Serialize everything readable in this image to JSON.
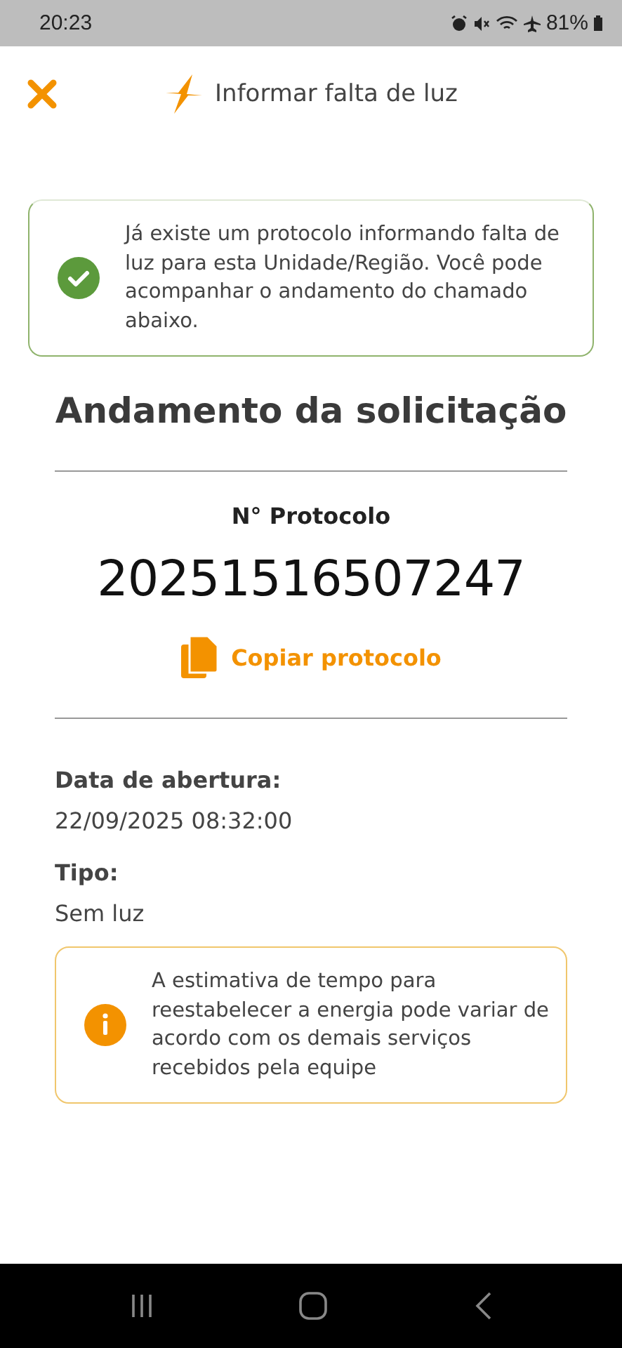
{
  "status_bar": {
    "time": "20:23",
    "battery": "81%"
  },
  "header": {
    "title": "Informar falta de luz"
  },
  "notice": {
    "kind": "success",
    "text": "Já existe um protocolo informando falta de luz para esta Unidade/Região. Você pode acompanhar o andamento do chamado abaixo."
  },
  "heading": "Andamento da solicitação",
  "protocol": {
    "label": "N° Protocolo",
    "number": "20251516507247",
    "copy_label": "Copiar protocolo"
  },
  "fields": [
    {
      "label": "Data de abertura:",
      "value": "22/09/2025 08:32:00"
    },
    {
      "label": "Tipo:",
      "value": "Sem luz"
    }
  ],
  "info": {
    "kind": "info",
    "text": "A estimativa de tempo para reestabelecer a energia pode variar de acordo com os demais serviços recebidos pela equipe"
  }
}
